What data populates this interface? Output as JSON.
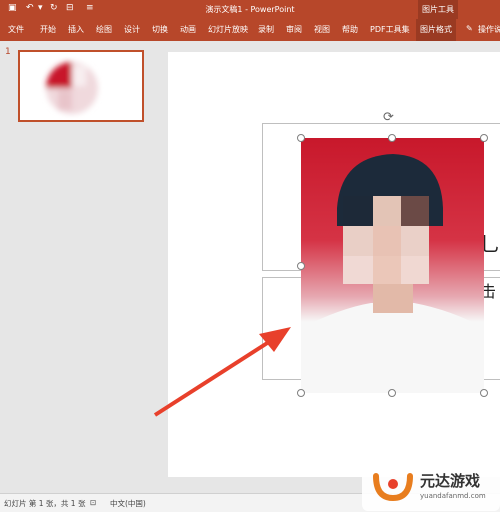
{
  "titlebar": {
    "title": "演示文稿1 - PowerPoint",
    "context_tab": "图片工具",
    "quick_access": [
      "save-icon",
      "undo-icon",
      "redo-icon",
      "present-icon",
      "customize-icon"
    ]
  },
  "ribbon": {
    "tabs": [
      "文件",
      "开始",
      "插入",
      "绘图",
      "设计",
      "切换",
      "动画",
      "幻灯片放映",
      "录制",
      "审阅",
      "视图",
      "帮助",
      "PDF工具集",
      "图片格式"
    ],
    "tell_me": "操作说"
  },
  "thumbnail": {
    "number": "1"
  },
  "slide_text": {
    "glyph1": "乚",
    "glyph2": "击"
  },
  "statusbar": {
    "slide_info": "幻灯片 第 1 张，共 1 张",
    "language": "中文(中国)"
  },
  "watermark": {
    "name": "元达游戏",
    "url": "yuandafanmd.com"
  },
  "colors": {
    "accent": "#b7472a",
    "arrow": "#e8402b",
    "photo_bg": "#c8182b"
  }
}
